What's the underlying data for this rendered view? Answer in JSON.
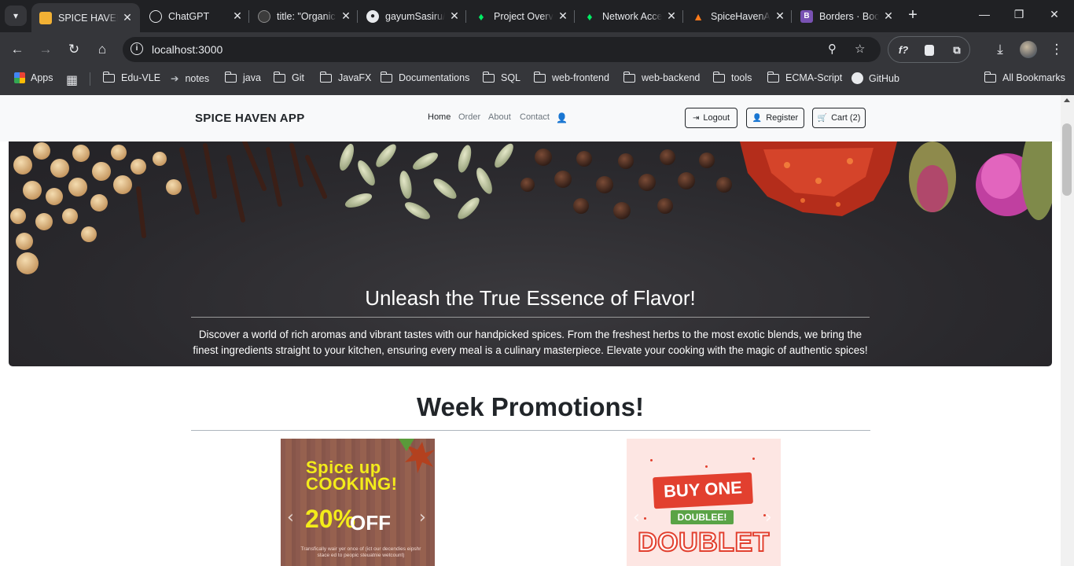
{
  "browser": {
    "tabs": [
      {
        "title": "SPICE HAVEN APP",
        "active": true,
        "favicon": "spice-haven-icon"
      },
      {
        "title": "ChatGPT",
        "favicon": "chatgpt-icon"
      },
      {
        "title": "title: \"Organic Spices\"",
        "favicon": "ai-icon"
      },
      {
        "title": "gayumSasiru/Spice-Haven",
        "favicon": "github-icon"
      },
      {
        "title": "Project Overview",
        "favicon": "mongodb-icon"
      },
      {
        "title": "Network Access",
        "favicon": "mongodb-icon"
      },
      {
        "title": "SpiceHavenApp",
        "favicon": "firebase-icon"
      },
      {
        "title": "Borders · Bootstrap",
        "favicon": "bootstrap-icon"
      }
    ],
    "url": "localhost:3000",
    "bookmarks": [
      {
        "label": "Apps",
        "icon": "apps-grid-icon"
      },
      {
        "label": "",
        "icon": "tab-groups-icon"
      },
      {
        "label": "Edu-VLE",
        "icon": "folder-icon"
      },
      {
        "label": "notes",
        "icon": "arrow-right-icon"
      },
      {
        "label": "java",
        "icon": "folder-icon"
      },
      {
        "label": "Git",
        "icon": "folder-icon"
      },
      {
        "label": "JavaFX",
        "icon": "folder-icon"
      },
      {
        "label": "Documentations",
        "icon": "folder-icon"
      },
      {
        "label": "SQL",
        "icon": "folder-icon"
      },
      {
        "label": "web-frontend",
        "icon": "folder-icon"
      },
      {
        "label": "web-backend",
        "icon": "folder-icon"
      },
      {
        "label": "tools",
        "icon": "folder-icon"
      },
      {
        "label": "ECMA-Script",
        "icon": "folder-icon"
      },
      {
        "label": "GitHub",
        "icon": "github-icon"
      }
    ],
    "all_bookmarks": "All Bookmarks"
  },
  "site": {
    "brand": "SPICE HAVEN APP",
    "nav": [
      "Home",
      "Order",
      "About",
      "Contact"
    ],
    "buttons": {
      "logout": "Logout",
      "register": "Register",
      "cart": "Cart (2)"
    }
  },
  "hero": {
    "title": "Unleash the True Essence of Flavor!",
    "text": "Discover a world of rich aromas and vibrant tastes with our handpicked spices. From the freshest herbs to the most exotic blends, we bring the finest ingredients straight to your kitchen, ensuring every meal is a culinary masterpiece. Elevate your cooking with the magic of authentic spices!"
  },
  "promotions": {
    "title": "Week Promotions!",
    "card1": {
      "line1": "Spice up",
      "line2": "COOKING!",
      "percent": "20%",
      "off": "OFF",
      "fine_print": "Transfically wair yer once of (ict our decendies eipshr stace ed to peopic steuatnie wetcount)"
    },
    "card2": {
      "banner": "BUY ONE",
      "pill": "DOUBLEE!",
      "big": "DOUBLET"
    }
  },
  "colors": {
    "accent_yellow": "#f3ec1a",
    "promo_red": "#e2402f",
    "promo_green": "#5aa346"
  }
}
